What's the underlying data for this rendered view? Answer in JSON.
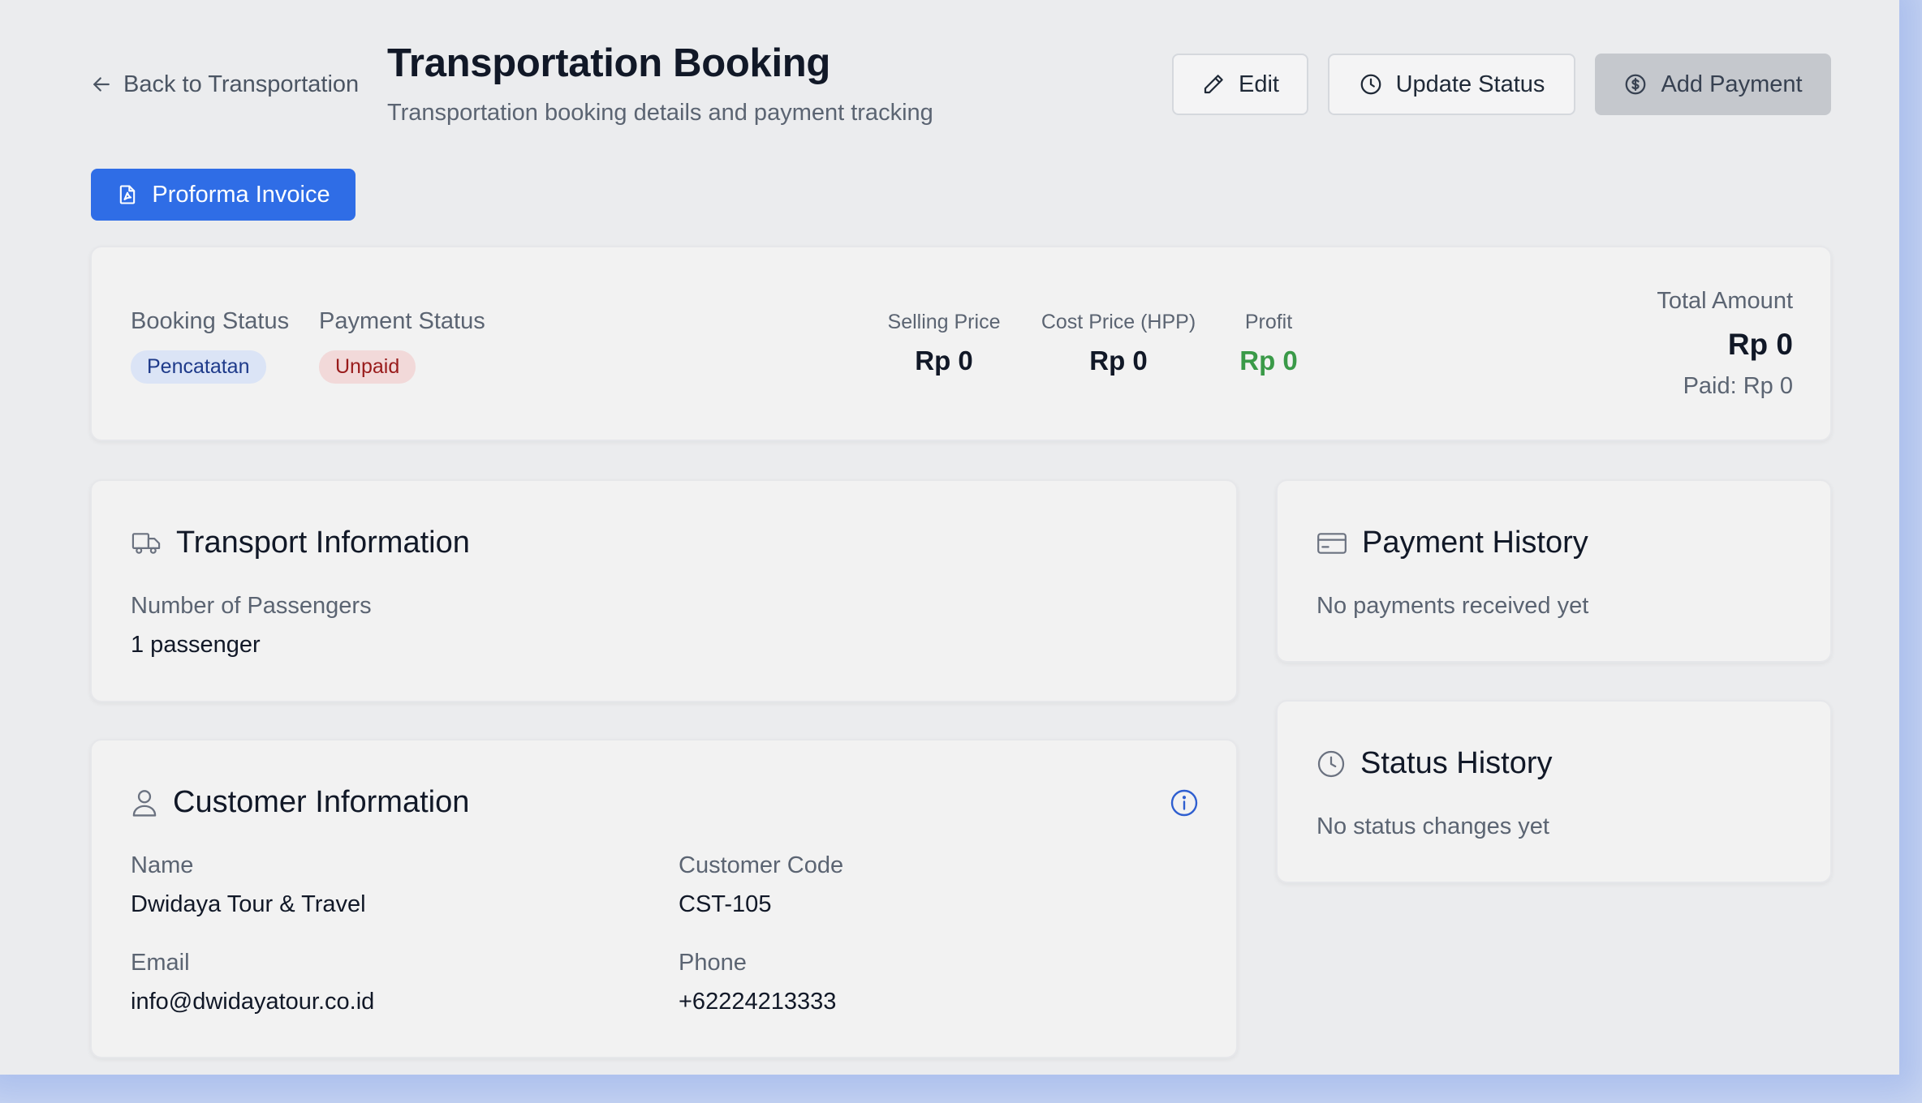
{
  "header": {
    "back_label": "Back to Transportation",
    "title": "Transportation Booking",
    "subtitle": "Transportation booking details and payment tracking",
    "edit_label": "Edit",
    "update_status_label": "Update Status",
    "add_payment_label": "Add Payment",
    "proforma_label": "Proforma Invoice"
  },
  "summary": {
    "booking_status_label": "Booking Status",
    "booking_status_value": "Pencatatan",
    "payment_status_label": "Payment Status",
    "payment_status_value": "Unpaid",
    "selling_price_label": "Selling Price",
    "selling_price_value": "Rp 0",
    "cost_price_label": "Cost Price (HPP)",
    "cost_price_value": "Rp 0",
    "profit_label": "Profit",
    "profit_value": "Rp 0",
    "total_amount_label": "Total Amount",
    "total_amount_value": "Rp 0",
    "paid_text": "Paid: Rp 0"
  },
  "transport": {
    "title": "Transport Information",
    "passengers_label": "Number of Passengers",
    "passengers_value": "1 passenger"
  },
  "customer": {
    "title": "Customer Information",
    "name_label": "Name",
    "name_value": "Dwidaya Tour & Travel",
    "code_label": "Customer Code",
    "code_value": "CST-105",
    "email_label": "Email",
    "email_value": "info@dwidayatour.co.id",
    "phone_label": "Phone",
    "phone_value": "+62224213333"
  },
  "payment_history": {
    "title": "Payment History",
    "empty_text": "No payments received yet"
  },
  "status_history": {
    "title": "Status History",
    "empty_text": "No status changes yet"
  },
  "colors": {
    "primary": "#2f6de6",
    "profit": "#3a9a48",
    "info_icon": "#2f5fd0",
    "page_bg": "#ebecee"
  },
  "icons": {
    "back": "arrow-left-icon",
    "edit": "pencil-icon",
    "update_status": "clock-icon",
    "add_payment": "dollar-circle-icon",
    "proforma": "file-pdf-icon",
    "transport": "truck-icon",
    "customer": "user-icon",
    "info": "info-icon",
    "payment_history": "credit-card-icon",
    "status_history": "clock-icon"
  }
}
